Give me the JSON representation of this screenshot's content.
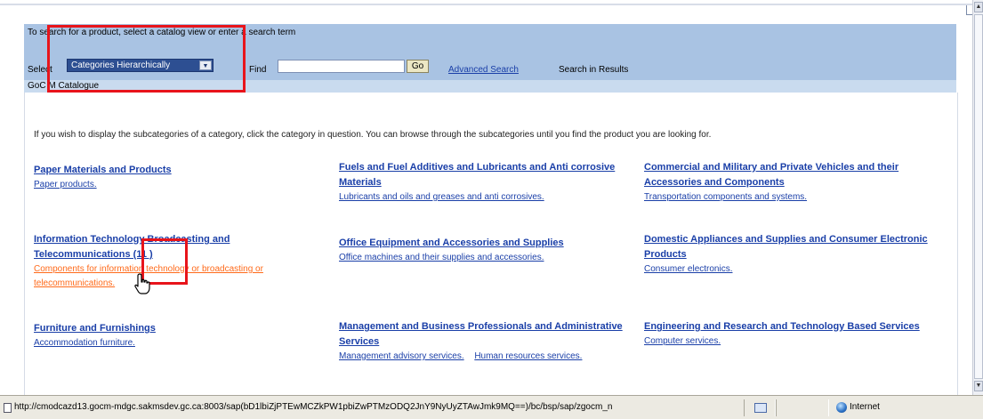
{
  "search": {
    "hint": "To search for a product, select a catalog view or enter a search term",
    "select_label": "Select",
    "catalog_view_value": "Categories Hierarchically",
    "find_label": "Find",
    "find_value": "",
    "go_label": "Go",
    "advanced_search_label": "Advanced Search",
    "search_in_results_label": "Search in Results",
    "catalogue_label": "GoC M Catalogue"
  },
  "content": {
    "intro": "If you wish to display the subcategories of a category, click the category in question. You can browse through the subcategories until you find the product you are looking for.",
    "categories": [
      {
        "title": "Paper Materials and Products",
        "subs": [
          "Paper products."
        ]
      },
      {
        "title": "Fuels and Fuel Additives and Lubricants and Anti corrosive Materials",
        "subs": [
          "Lubricants and oils and greases and anti corrosives."
        ]
      },
      {
        "title": "Commercial and Military and Private Vehicles and their Accessories and Components",
        "subs": [
          "Transportation components and systems."
        ]
      },
      {
        "title": "Information Technology Broadcasting and Telecommunications (11 )",
        "subs": [
          "Components for information technology or broadcasting or telecommunications."
        ]
      },
      {
        "title": "Office Equipment and Accessories and Supplies",
        "subs": [
          "Office machines and their supplies and accessories."
        ]
      },
      {
        "title": "Domestic Appliances and Supplies and Consumer Electronic Products",
        "subs": [
          "Consumer electronics."
        ]
      },
      {
        "title": "Furniture and Furnishings",
        "subs": [
          "Accommodation furniture."
        ]
      },
      {
        "title": "Management and Business Professionals and Administrative Services",
        "subs": [
          "Management advisory services.",
          "Human resources services."
        ]
      },
      {
        "title": "Engineering and Research and Technology Based Services",
        "subs": [
          "Computer services."
        ]
      }
    ]
  },
  "statusbar": {
    "url": "http://cmodcazd13.gocm-mdgc.sakmsdev.gc.ca:8003/sap(bD1lbiZjPTEwMCZkPW1pbiZwPTMzODQ2JnY9NyUyZTAwJmk9MQ==)/bc/bsp/sap/zgocm_n",
    "zone": "Internet"
  },
  "colors": {
    "panel": "#a9c3e3",
    "link": "#1a3fa8",
    "visited_link": "#ff6a1a",
    "highlight": "#e8141b"
  }
}
